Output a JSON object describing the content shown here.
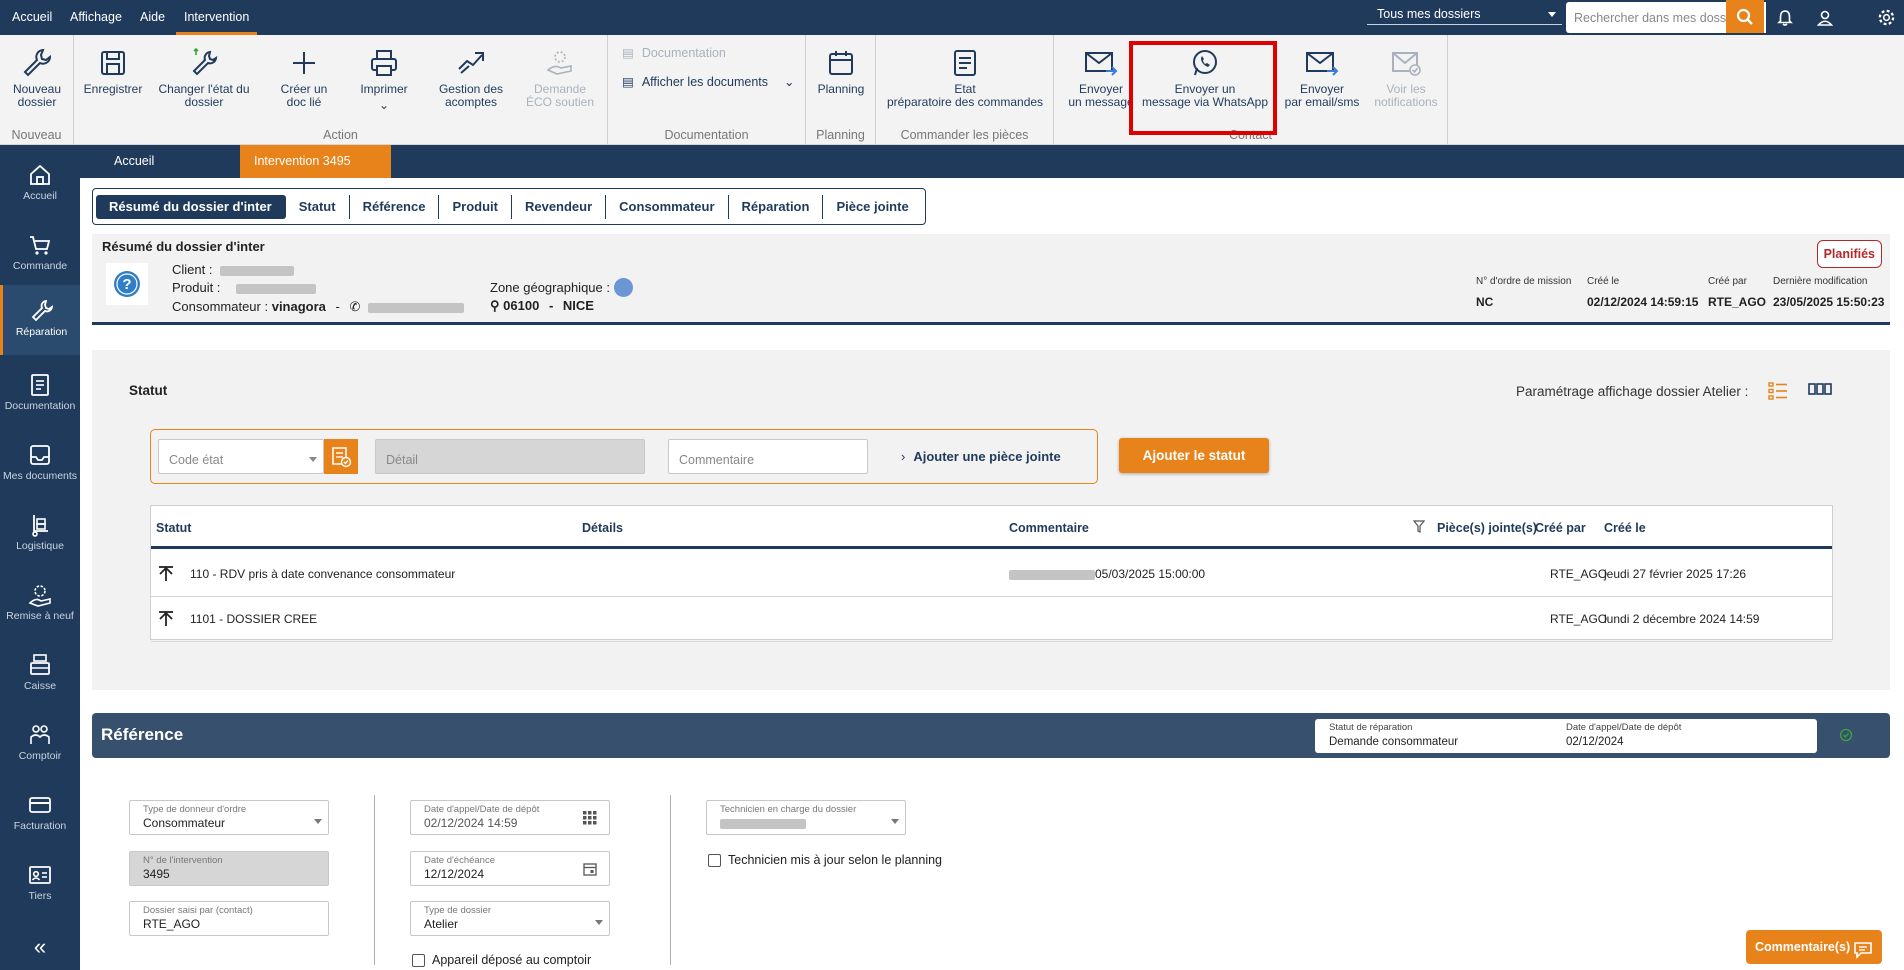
{
  "menubar": {
    "items": [
      "Accueil",
      "Affichage",
      "Aide",
      "Intervention"
    ],
    "dossier_select": "Tous mes dossiers",
    "search_placeholder": "Rechercher dans mes dossiers"
  },
  "ribbon": {
    "nouveau": {
      "btn": "Nouveau dossier",
      "group": "Nouveau"
    },
    "action": {
      "group": "Action",
      "buttons": [
        "Enregistrer",
        "Changer l'état du dossier",
        "Créer un doc lié",
        "Imprimer",
        "Gestion des acomptes",
        "Demande ÉCO soutien"
      ]
    },
    "documentation": {
      "group": "Documentation",
      "item1": "Documentation",
      "item2": "Afficher les documents"
    },
    "planning": {
      "btn": "Planning",
      "group": "Planning"
    },
    "commander": {
      "btn_l1": "Etat",
      "btn_l2": "préparatoire des commandes",
      "group": "Commander les pièces"
    },
    "contact": {
      "group": "Contact",
      "b1_l1": "Envoyer",
      "b1_l2": "un message",
      "b2_l1": "Envoyer un",
      "b2_l2": "message via WhatsApp",
      "b3_l1": "Envoyer",
      "b3_l2": "par email/sms",
      "b4_l1": "Voir les",
      "b4_l2": "notifications"
    }
  },
  "sidebar": {
    "items": [
      "Accueil",
      "Commande",
      "Réparation",
      "Documentation",
      "Mes documents",
      "Logistique",
      "Remise à neuf",
      "Caisse",
      "Comptoir",
      "Facturation",
      "Tiers"
    ],
    "collapse": "«"
  },
  "tabs": {
    "home": "Accueil",
    "active": "Intervention 3495",
    "close": "✕"
  },
  "subtabs": [
    "Résumé du dossier d'inter",
    "Statut",
    "Référence",
    "Produit",
    "Revendeur",
    "Consommateur",
    "Réparation",
    "Pièce jointe"
  ],
  "summary": {
    "title": "Résumé du dossier d'inter",
    "client_label": "Client :",
    "produit_label": "Produit :",
    "consommateur_label": "Consommateur :",
    "consommateur_value": "vinagora",
    "consommateur_sep": "-",
    "zone_label": "Zone géographique :",
    "postal": "06100",
    "zone_sep": "-",
    "city": "NICE",
    "badge": "Planifiés",
    "meta": [
      {
        "label": "N° d'ordre de mission",
        "value": "NC"
      },
      {
        "label": "Créé le",
        "value": "02/12/2024 14:59:15"
      },
      {
        "label": "Créé par",
        "value": "RTE_AGO"
      },
      {
        "label": "Dernière modification",
        "value": "23/05/2025 15:50:23"
      }
    ]
  },
  "statut": {
    "title": "Statut",
    "parametrage": "Paramétrage affichage dossier Atelier :",
    "form": {
      "code_placeholder": "Code état",
      "detail_placeholder": "Détail",
      "comment_placeholder": "Commentaire",
      "attach": "Ajouter une pièce jointe",
      "add_button": "Ajouter le statut"
    },
    "table": {
      "headers": [
        "Statut",
        "Détails",
        "Commentaire",
        "Pièce(s) jointe(s)",
        "Créé par",
        "Créé le"
      ],
      "rows": [
        {
          "statut": "110 - RDV pris à date convenance consommateur",
          "details": "",
          "comment": "05/03/2025 15:00:00",
          "pj": "",
          "by": "RTE_AGO",
          "date": "jeudi 27 février 2025 17:26"
        },
        {
          "statut": "1101 - DOSSIER CREE",
          "details": "",
          "comment": "",
          "pj": "",
          "by": "RTE_AGO",
          "date": "lundi 2 décembre 2024 14:59"
        }
      ]
    }
  },
  "reference": {
    "title": "Référence",
    "info": {
      "statut_label": "Statut de réparation",
      "statut_value": "Demande consommateur",
      "date_label": "Date d'appel/Date de dépôt",
      "date_value": "02/12/2024"
    },
    "fields": {
      "type_donneur": {
        "label": "Type de donneur d'ordre",
        "value": "Consommateur"
      },
      "num_intervention": {
        "label": "N° de l'intervention",
        "value": "3495"
      },
      "dossier_saisi": {
        "label": "Dossier saisi par (contact)",
        "value": "RTE_AGO"
      },
      "date_appel": {
        "label": "Date d'appel/Date de dépôt",
        "value": "02/12/2024 14:59"
      },
      "date_echeance": {
        "label": "Date d'échéance",
        "value": "12/12/2024"
      },
      "type_dossier": {
        "label": "Type de dossier",
        "value": "Atelier"
      },
      "technicien": {
        "label": "Technicien en charge du dossier",
        "value": ""
      }
    },
    "checkbox_tech": "Technicien mis à jour selon le planning",
    "checkbox_appareil": "Appareil déposé au comptoir"
  },
  "comments_button": "Commentaire(s)",
  "colors": {
    "navy": "#1f3a5a",
    "accent": "#e8821a",
    "highlight": "#e00000"
  }
}
